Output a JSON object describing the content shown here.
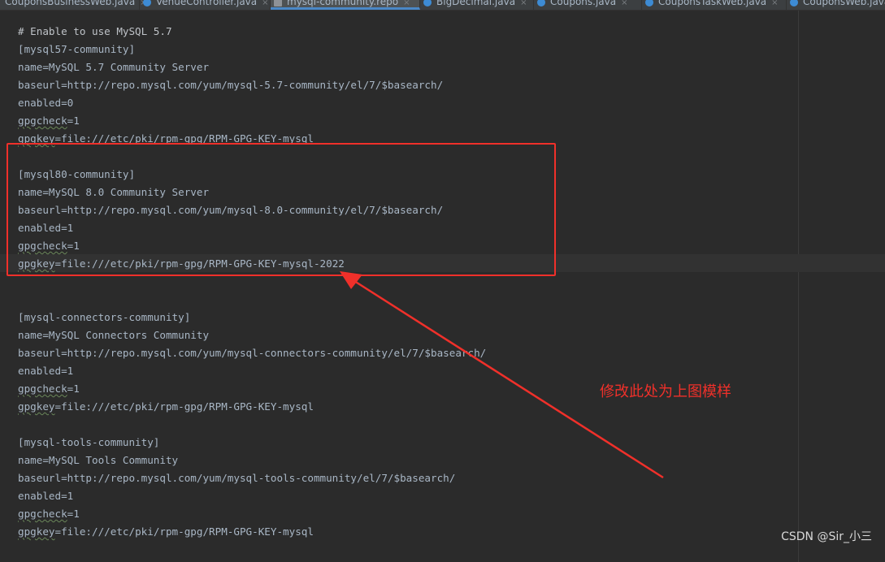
{
  "tabs": [
    {
      "label": "CouponsBusinessWeb.java",
      "icon": "java-class-icon",
      "active": false
    },
    {
      "label": "VenueController.java",
      "icon": "java-class-icon",
      "active": false
    },
    {
      "label": "mysql-community.repo",
      "icon": "text-file-icon",
      "active": true
    },
    {
      "label": "BigDecimal.java",
      "icon": "java-class-icon",
      "active": false
    },
    {
      "label": "Coupons.java",
      "icon": "java-class-icon",
      "active": false
    },
    {
      "label": "CouponsTaskWeb.java",
      "icon": "java-class-icon",
      "active": false
    },
    {
      "label": "CouponsWeb.java",
      "icon": "java-class-icon",
      "active": false
    }
  ],
  "code": [
    {
      "n": 0,
      "text": "# Enable to use MySQL 5.7"
    },
    {
      "n": 1,
      "text": "[mysql57-community]"
    },
    {
      "n": 2,
      "text": "name=MySQL 5.7 Community Server"
    },
    {
      "n": 3,
      "text": "baseurl=http://repo.mysql.com/yum/mysql-5.7-community/el/7/$basearch/"
    },
    {
      "n": 4,
      "text": "enabled=0"
    },
    {
      "n": 5,
      "text": "gpgcheck=1"
    },
    {
      "n": 6,
      "text": "gpgkey=file:///etc/pki/rpm-gpg/RPM-GPG-KEY-mysql"
    },
    {
      "n": 7,
      "text": ""
    },
    {
      "n": 8,
      "text": "[mysql80-community]"
    },
    {
      "n": 9,
      "text": "name=MySQL 8.0 Community Server"
    },
    {
      "n": 10,
      "text": "baseurl=http://repo.mysql.com/yum/mysql-8.0-community/el/7/$basearch/"
    },
    {
      "n": 11,
      "text": "enabled=1"
    },
    {
      "n": 12,
      "text": "gpgcheck=1"
    },
    {
      "n": 13,
      "text": "gpgkey=file:///etc/pki/rpm-gpg/RPM-GPG-KEY-mysql-2022"
    },
    {
      "n": 14,
      "text": ""
    },
    {
      "n": 15,
      "text": ""
    },
    {
      "n": 16,
      "text": "[mysql-connectors-community]"
    },
    {
      "n": 17,
      "text": "name=MySQL Connectors Community"
    },
    {
      "n": 18,
      "text": "baseurl=http://repo.mysql.com/yum/mysql-connectors-community/el/7/$basearch/"
    },
    {
      "n": 19,
      "text": "enabled=1"
    },
    {
      "n": 20,
      "text": "gpgcheck=1"
    },
    {
      "n": 21,
      "text": "gpgkey=file:///etc/pki/rpm-gpg/RPM-GPG-KEY-mysql"
    },
    {
      "n": 22,
      "text": ""
    },
    {
      "n": 23,
      "text": "[mysql-tools-community]"
    },
    {
      "n": 24,
      "text": "name=MySQL Tools Community"
    },
    {
      "n": 25,
      "text": "baseurl=http://repo.mysql.com/yum/mysql-tools-community/el/7/$basearch/"
    },
    {
      "n": 26,
      "text": "enabled=1"
    },
    {
      "n": 27,
      "text": "gpgcheck=1"
    },
    {
      "n": 28,
      "text": "gpgkey=file:///etc/pki/rpm-gpg/RPM-GPG-KEY-mysql"
    }
  ],
  "annotation": {
    "text": "修改此处为上图模样",
    "color": "#f0302a"
  },
  "watermark": "CSDN @Sir_小三",
  "colors": {
    "editor_bg": "#2b2b2b",
    "text": "#a9b7c6",
    "tabbar_bg": "#3c3f41",
    "active_tab_accent": "#4a88c7",
    "caret_row": "#323232"
  }
}
